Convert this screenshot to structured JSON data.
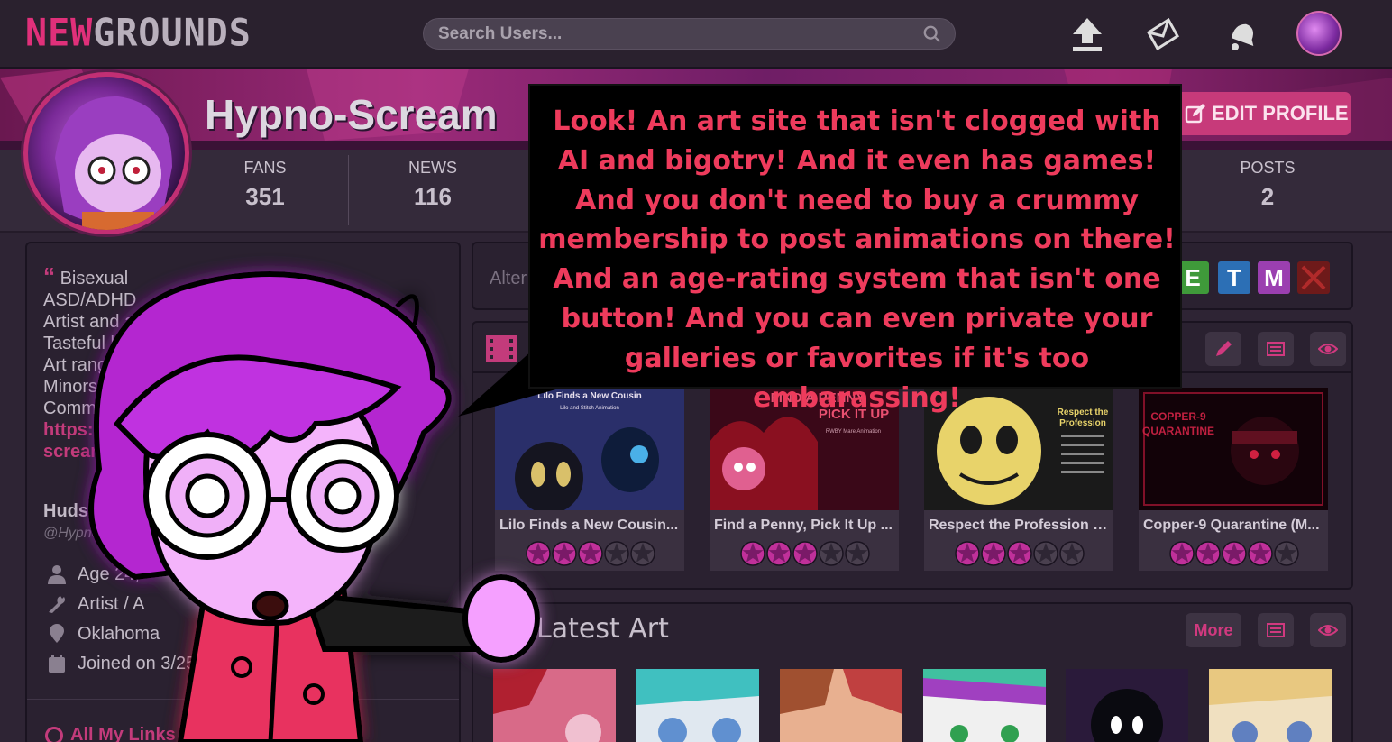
{
  "topbar": {
    "logo_new": "NEW",
    "logo_grounds": "GROUNDS",
    "search_placeholder": "Search Users...",
    "icons": [
      "upload-icon",
      "mail-icon",
      "bell-icon",
      "user-avatar"
    ]
  },
  "profile": {
    "username": "Hypno-Scream",
    "edit_label": "EDIT PROFILE",
    "stats": [
      {
        "label": "FANS",
        "value": "351"
      },
      {
        "label": "NEWS",
        "value": "116"
      },
      {
        "label": "POSTS",
        "value": "2"
      }
    ]
  },
  "sidebar": {
    "bio_lines": [
      "Bisexual",
      "ASD/ADHD",
      "Artist and anir",
      "Tasteful hyp",
      "Art ranges",
      "Minors D",
      "Commis"
    ],
    "bio_link_1": "https://",
    "bio_link_2": "scream",
    "real_name": "Hudson",
    "handle": "@Hypno-Sc",
    "info": [
      {
        "icon": "person-icon",
        "text": "Age 24,"
      },
      {
        "icon": "wrench-icon",
        "text": "Artist / A"
      },
      {
        "icon": "location-pin-icon",
        "text": "Oklahoma"
      },
      {
        "icon": "calendar-icon",
        "text": "Joined on 3/25"
      }
    ],
    "all_links": "All My Links"
  },
  "ratings_panel": {
    "label": "Alter",
    "chips": [
      {
        "letter": "E",
        "color": "#3f9a3a"
      },
      {
        "letter": "T",
        "color": "#2c6fb5"
      },
      {
        "letter": "M",
        "color": "#9b3fb0"
      },
      {
        "letter": "",
        "color": "#b02a2a"
      }
    ]
  },
  "movies": {
    "items": [
      {
        "title": "Lilo Finds a New Cousin...",
        "stars": 3
      },
      {
        "title": "Find a Penny, Pick It Up ...",
        "stars": 3
      },
      {
        "title": "Respect the Profession (...",
        "stars": 3
      },
      {
        "title": "Copper-9 Quarantine (M...",
        "stars": 4
      }
    ],
    "thumb_texts": {
      "lilo_title": "Lilo Finds a New Cousin",
      "lilo_sub": "Lilo and Stitch Animation",
      "penny_1": "FIND A PENNY",
      "penny_2": "PICK IT UP",
      "penny_sub": "RWBY Mare Animation",
      "respect_1": "Respect the",
      "respect_2": "Profession",
      "copper_1": "COPPER-9",
      "copper_2": "QUARANTINE"
    }
  },
  "art": {
    "title": "Latest Art",
    "more_label": "More"
  },
  "meme": {
    "lines": [
      "Look! An art site that isn't clogged with",
      "AI and bigotry! And it even has games!",
      "And you don't need to buy a crummy",
      "membership to post animations on there!",
      "And an age-rating system that isn't one",
      "button! And you can even private your",
      "galleries or favorites if it's too embarassing!"
    ]
  },
  "colors": {
    "accent": "#c33b7b",
    "speech_text": "#ee3b5c",
    "background": "#2e2434"
  }
}
